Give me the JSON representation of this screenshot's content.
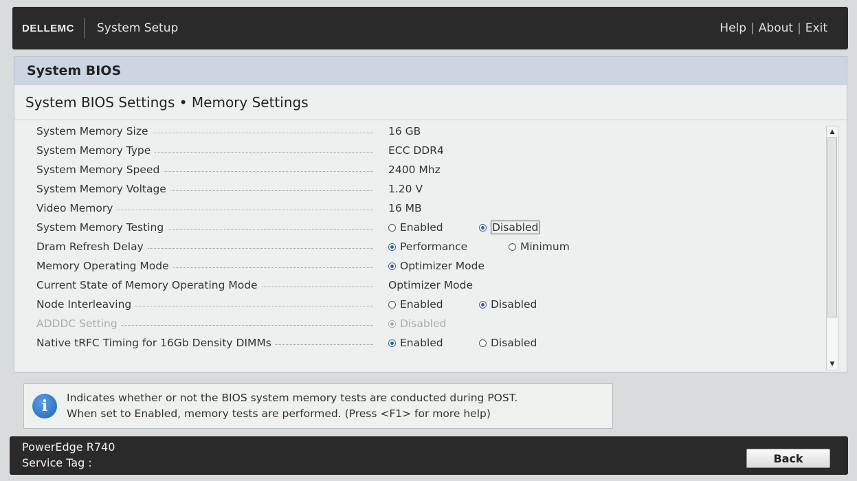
{
  "header": {
    "brand": "DELLEMC",
    "title": "System Setup",
    "links": [
      "Help",
      "About",
      "Exit"
    ],
    "separator": "|"
  },
  "panel": {
    "heading": "System BIOS",
    "section_title": "System BIOS Settings • Memory Settings"
  },
  "settings": [
    {
      "label": "System Memory Size",
      "value": "16 GB"
    },
    {
      "label": "System Memory Type",
      "value": "ECC DDR4"
    },
    {
      "label": "System Memory Speed",
      "value": "2400 Mhz"
    },
    {
      "label": "System Memory Voltage",
      "value": "1.20 V"
    },
    {
      "label": "Video Memory",
      "value": "16 MB"
    },
    {
      "label": "System Memory Testing",
      "options": [
        "Enabled",
        "Disabled"
      ],
      "selected": "Disabled"
    },
    {
      "label": "Dram Refresh Delay",
      "options": [
        "Performance",
        "Minimum"
      ],
      "selected": "Performance"
    },
    {
      "label": "Memory Operating Mode",
      "options": [
        "Optimizer Mode"
      ],
      "selected": "Optimizer Mode"
    },
    {
      "label": "Current State of Memory Operating Mode",
      "value": "Optimizer Mode"
    },
    {
      "label": "Node Interleaving",
      "options": [
        "Enabled",
        "Disabled"
      ],
      "selected": "Disabled"
    },
    {
      "label": "ADDDC Setting",
      "options": [
        "Disabled"
      ],
      "selected": "Disabled",
      "disabled": true
    },
    {
      "label": "Native tRFC Timing for 16Gb Density DIMMs",
      "options": [
        "Enabled",
        "Disabled"
      ],
      "selected": "Enabled"
    }
  ],
  "help": {
    "line1": "Indicates whether or not the BIOS system memory tests are conducted during POST.",
    "line2": "When set to Enabled, memory tests are performed. (Press <F1> for more help)"
  },
  "footer": {
    "model": "PowerEdge R740",
    "service_tag_label": "Service Tag :",
    "back_label": "Back"
  }
}
